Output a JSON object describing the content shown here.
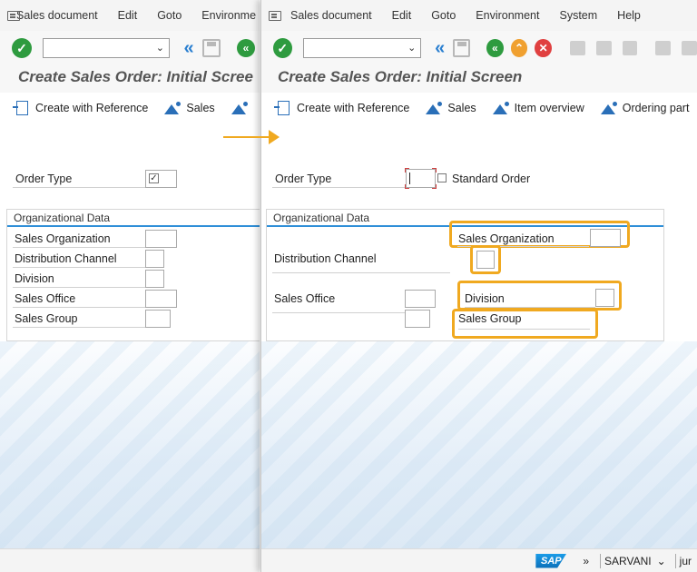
{
  "menu": {
    "items": [
      "Sales document",
      "Edit",
      "Goto",
      "Environment",
      "System",
      "Help"
    ],
    "left_truncated": [
      "Sales document",
      "Edit",
      "Goto",
      "Environme"
    ]
  },
  "title": "Create Sales Order: Initial Screen",
  "title_left_truncated": "Create Sales Order: Initial Scree",
  "app_toolbar": {
    "buttons": [
      "Create with Reference",
      "Sales",
      "Item overview",
      "Ordering part"
    ]
  },
  "fields": {
    "order_type": "Order Type",
    "order_type_value": "Standard Order"
  },
  "org_data": {
    "title": "Organizational Data",
    "sales_organization": "Sales Organization",
    "distribution_channel": "Distribution Channel",
    "division": "Division",
    "sales_office": "Sales Office",
    "sales_group": "Sales Group"
  },
  "status": {
    "arrows": "»",
    "user": "SARVANI",
    "trailing": "jur"
  },
  "colors": {
    "highlight": "#f0a920",
    "accent_blue": "#2f8fd8",
    "enter_green": "#2e9b3f"
  },
  "icons": [
    "enter-icon",
    "back-double-icon",
    "save-icon",
    "back-icon",
    "exit-icon",
    "cancel-icon",
    "print-icon",
    "find-icon",
    "sap-logo"
  ]
}
